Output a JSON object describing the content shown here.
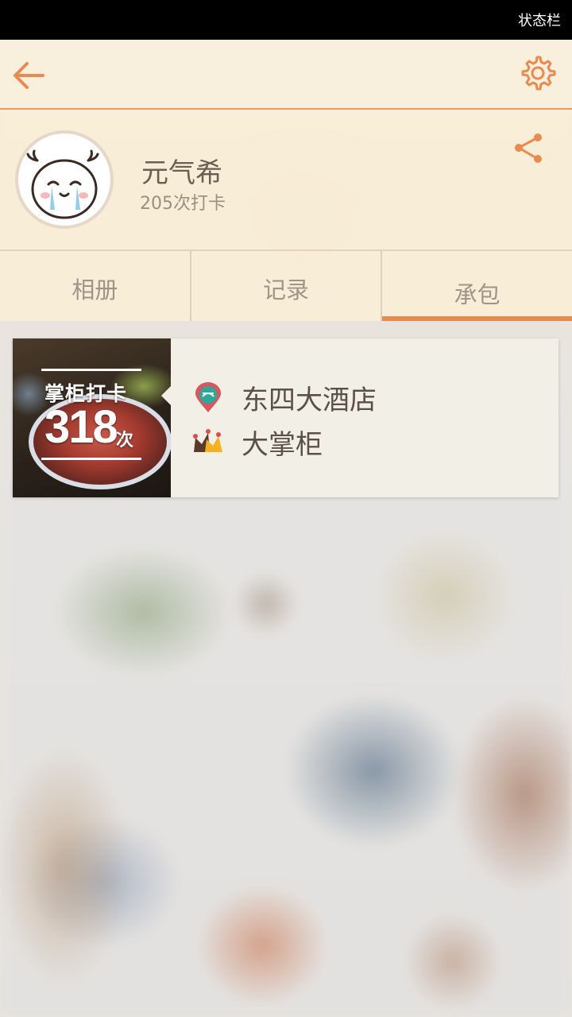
{
  "status_bar": {
    "text": "状态栏"
  },
  "profile": {
    "username": "元气希",
    "checkins": "205次打卡"
  },
  "tabs": [
    {
      "label": "相册",
      "active": false
    },
    {
      "label": "记录",
      "active": false
    },
    {
      "label": "承包",
      "active": true
    }
  ],
  "card": {
    "badge_title": "掌柜打卡",
    "badge_count": "318",
    "badge_unit": "次",
    "venue_name": "东四大酒店",
    "rank_title": "大掌柜",
    "venue_icon": "location-pin-icon",
    "rank_icon": "crown-icon"
  },
  "colors": {
    "accent": "#ea8a4e",
    "header_bg": "#faf0de"
  },
  "icons": {
    "back": "back-arrow-icon",
    "settings": "gear-icon",
    "share": "share-icon"
  }
}
